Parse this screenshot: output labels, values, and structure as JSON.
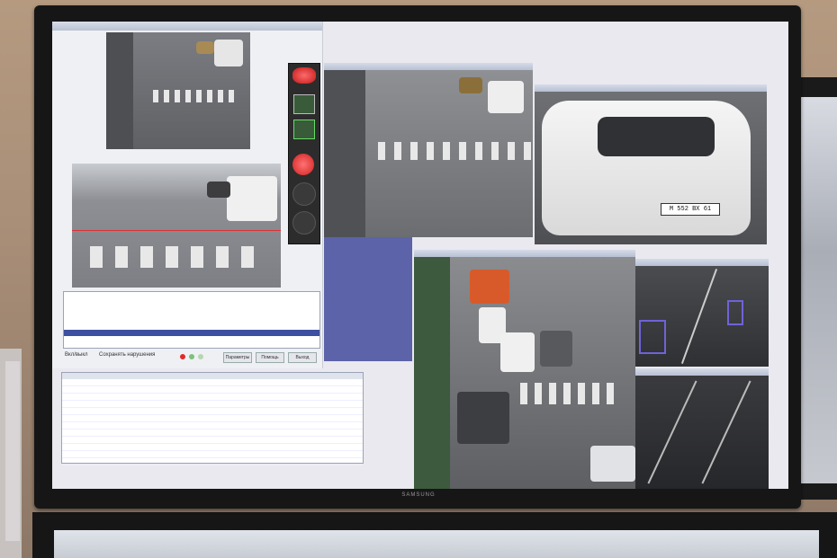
{
  "scene": {
    "description_label": "Traffic control center video wall",
    "monitor_brand": "SAMSUNG"
  },
  "left_app": {
    "title": "",
    "checkbox_1": "Вкл/выкл",
    "checkbox_2": "Сохранять нарушения",
    "buttons": [
      "Параметры",
      "Помощь",
      "Выход"
    ]
  },
  "plate_text": "М 552 ВХ 61",
  "colors": {
    "screen_bg": "#e9e9ef",
    "accent_blue": "#5c63a8",
    "selection": "#3c4fa0",
    "tracking_box": "#6f63d8",
    "red_light": "#e12a2a"
  }
}
